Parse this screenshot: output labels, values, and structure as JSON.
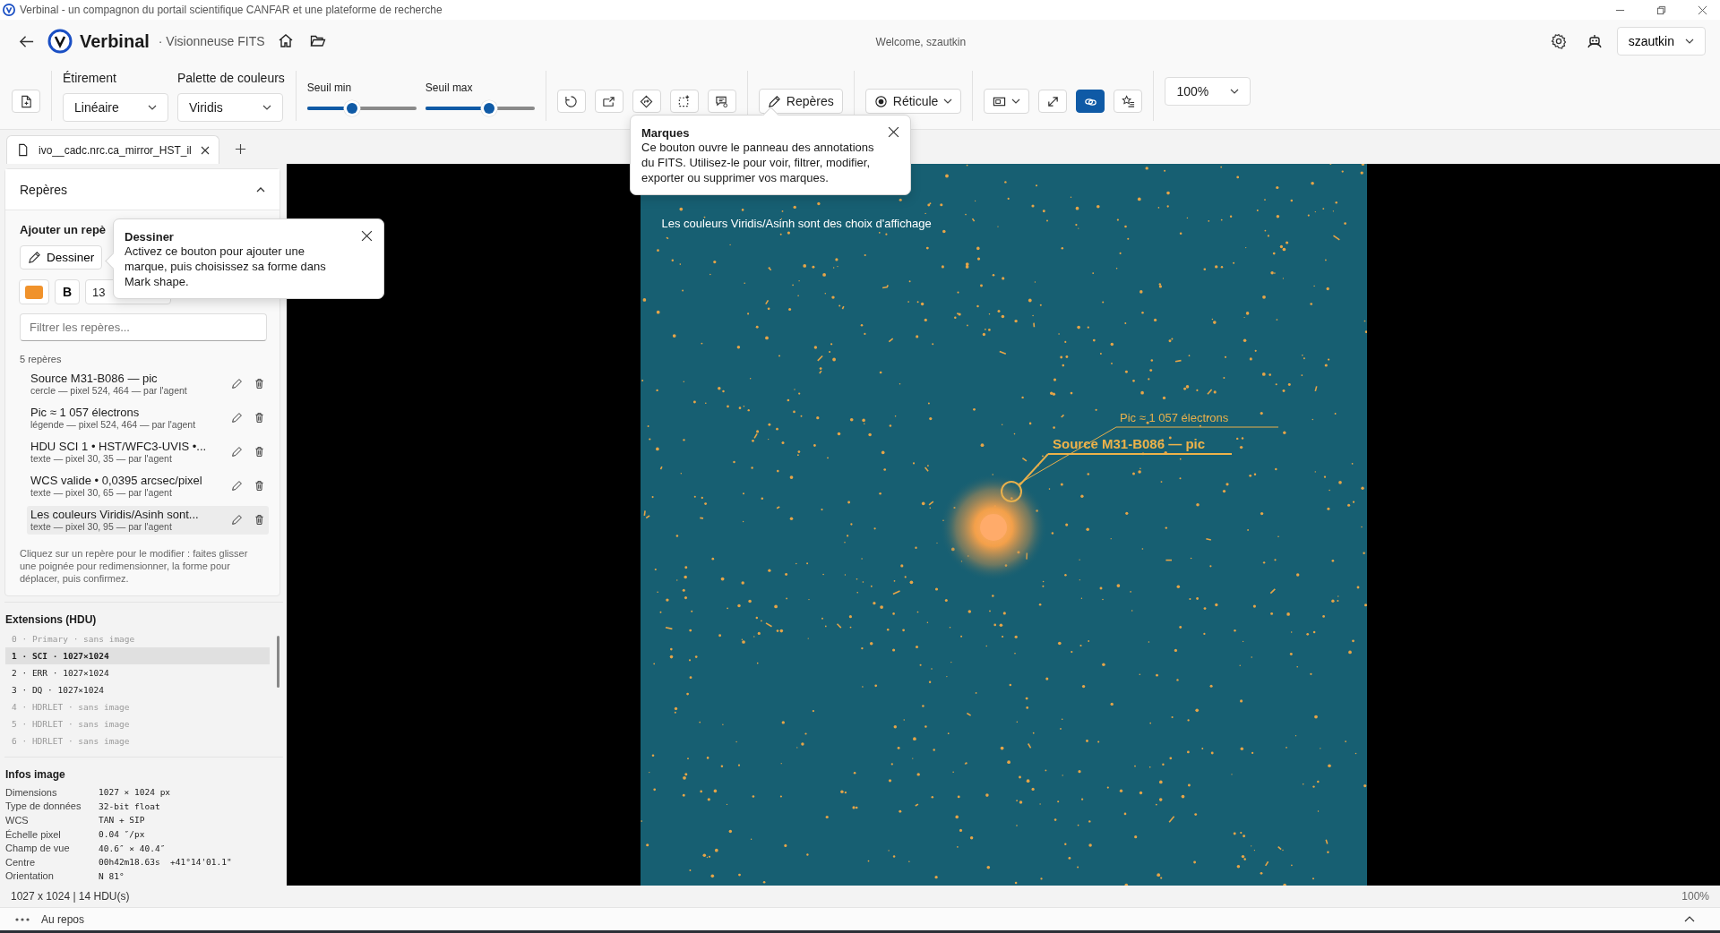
{
  "window": {
    "title": "Verbinal - un compagnon du portail scientifique CANFAR et une plateforme de recherche"
  },
  "header": {
    "app_name": "Verbinal",
    "subtitle": "· Visionneuse FITS",
    "welcome": "Welcome, szautkin",
    "user": "szautkin"
  },
  "toolbar": {
    "stretch": {
      "label": "Étirement",
      "value": "Linéaire"
    },
    "palette": {
      "label": "Palette de couleurs",
      "value": "Viridis"
    },
    "sliders": [
      {
        "label": "Seuil min",
        "level": 0.41
      },
      {
        "label": "Seuil max",
        "level": 0.58
      }
    ],
    "tools": [
      {
        "kind": "rotate",
        "active": false
      },
      {
        "kind": "export",
        "active": false
      },
      {
        "kind": "diamond",
        "active": false
      },
      {
        "kind": "select",
        "active": false
      },
      {
        "kind": "comment",
        "active": false
      },
      {
        "kind": "marks",
        "label": "Repères",
        "active": false
      },
      {
        "kind": "reticle",
        "label": "Réticule",
        "active": false
      },
      {
        "kind": "display",
        "active": false
      },
      {
        "kind": "expand",
        "active": false
      },
      {
        "kind": "link",
        "active": true
      },
      {
        "kind": "starlist",
        "active": false
      }
    ],
    "zoom": "100%"
  },
  "tabs": [
    {
      "label": "ivo__cadc.nrc.ca_mirror_HST_il",
      "selected": true
    }
  ],
  "marks_panel": {
    "title": "Repères",
    "expanded": true,
    "add_heading": "Ajouter un repè",
    "draw_button": "Dessiner",
    "color": "#f0922b",
    "bold_label": "B",
    "font_size": "13",
    "filter_placeholder": "Filtrer les repères...",
    "count": "5 repères",
    "items": [
      {
        "title": "Source M31-B086 — pic",
        "detail": "cercle — pixel 524, 464 — par l'agent",
        "selected": false
      },
      {
        "title": "Pic ≈ 1 057 électrons",
        "detail": "légende — pixel 524, 464 — par l'agent",
        "selected": false
      },
      {
        "title": "HDU SCI 1 • HST/WFC3-UVIS •...",
        "detail": "texte — pixel 30, 35 — par l'agent",
        "selected": false
      },
      {
        "title": "WCS valide • 0,0395 arcsec/pixel",
        "detail": "texte — pixel 30, 65 — par l'agent",
        "selected": false
      },
      {
        "title": "Les couleurs Viridis/Asinh sont...",
        "detail": "texte — pixel 30, 95 — par l'agent",
        "selected": true
      }
    ],
    "help": "Cliquez sur un repère pour le modifier : faites glisser une poignée pour redimensionner, la forme pour déplacer, puis confirmez."
  },
  "extensions": {
    "title": "Extensions (HDU)",
    "items": [
      {
        "label": "0 · Primary · sans image",
        "disabled": true,
        "selected": false
      },
      {
        "label": "1 · SCI · 1027×1024",
        "disabled": false,
        "selected": true
      },
      {
        "label": "2 · ERR · 1027×1024",
        "disabled": false,
        "selected": false
      },
      {
        "label": "3 · DQ · 1027×1024",
        "disabled": false,
        "selected": false
      },
      {
        "label": "4 · HDRLET · sans image",
        "disabled": true,
        "selected": false
      },
      {
        "label": "5 · HDRLET · sans image",
        "disabled": true,
        "selected": false
      },
      {
        "label": "6 · HDRLET · sans image",
        "disabled": true,
        "selected": false
      }
    ]
  },
  "image_info": {
    "title": "Infos image",
    "rows": [
      {
        "key": "Dimensions",
        "value": "1027 × 1024 px"
      },
      {
        "key": "Type de données",
        "value": "32-bit float"
      },
      {
        "key": "WCS",
        "value": "TAN + SIP"
      },
      {
        "key": "Échelle pixel",
        "value": "0.04 ″/px"
      },
      {
        "key": "Champ de vue",
        "value": "40.6″ × 40.4″"
      },
      {
        "key": "Centre",
        "value": "00h42m18.63s  +41°14'01.1\""
      },
      {
        "key": "Orientation",
        "value": "N 81°"
      }
    ]
  },
  "viewer": {
    "overlay_text": "Les couleurs Viridis/Asinh sont des choix d'affichage",
    "peak_label": "Pic ≈ 1 057 électrons",
    "source_label": "Source M31-B086 — pic"
  },
  "tooltips": [
    {
      "title": "Marques",
      "text": "Ce bouton ouvre le panneau des annotations du FITS. Utilisez-le pour voir, filtrer, modifier, exporter ou supprimer vos marques."
    },
    {
      "title": "Dessiner",
      "text": "Activez ce bouton pour ajouter une marque, puis choisissez sa forme dans Mark shape."
    }
  ],
  "status_bar": {
    "info": "1027 x 1024 | 14 HDU(s)",
    "zoom": "100%"
  },
  "activity": {
    "status": "Au repos"
  }
}
